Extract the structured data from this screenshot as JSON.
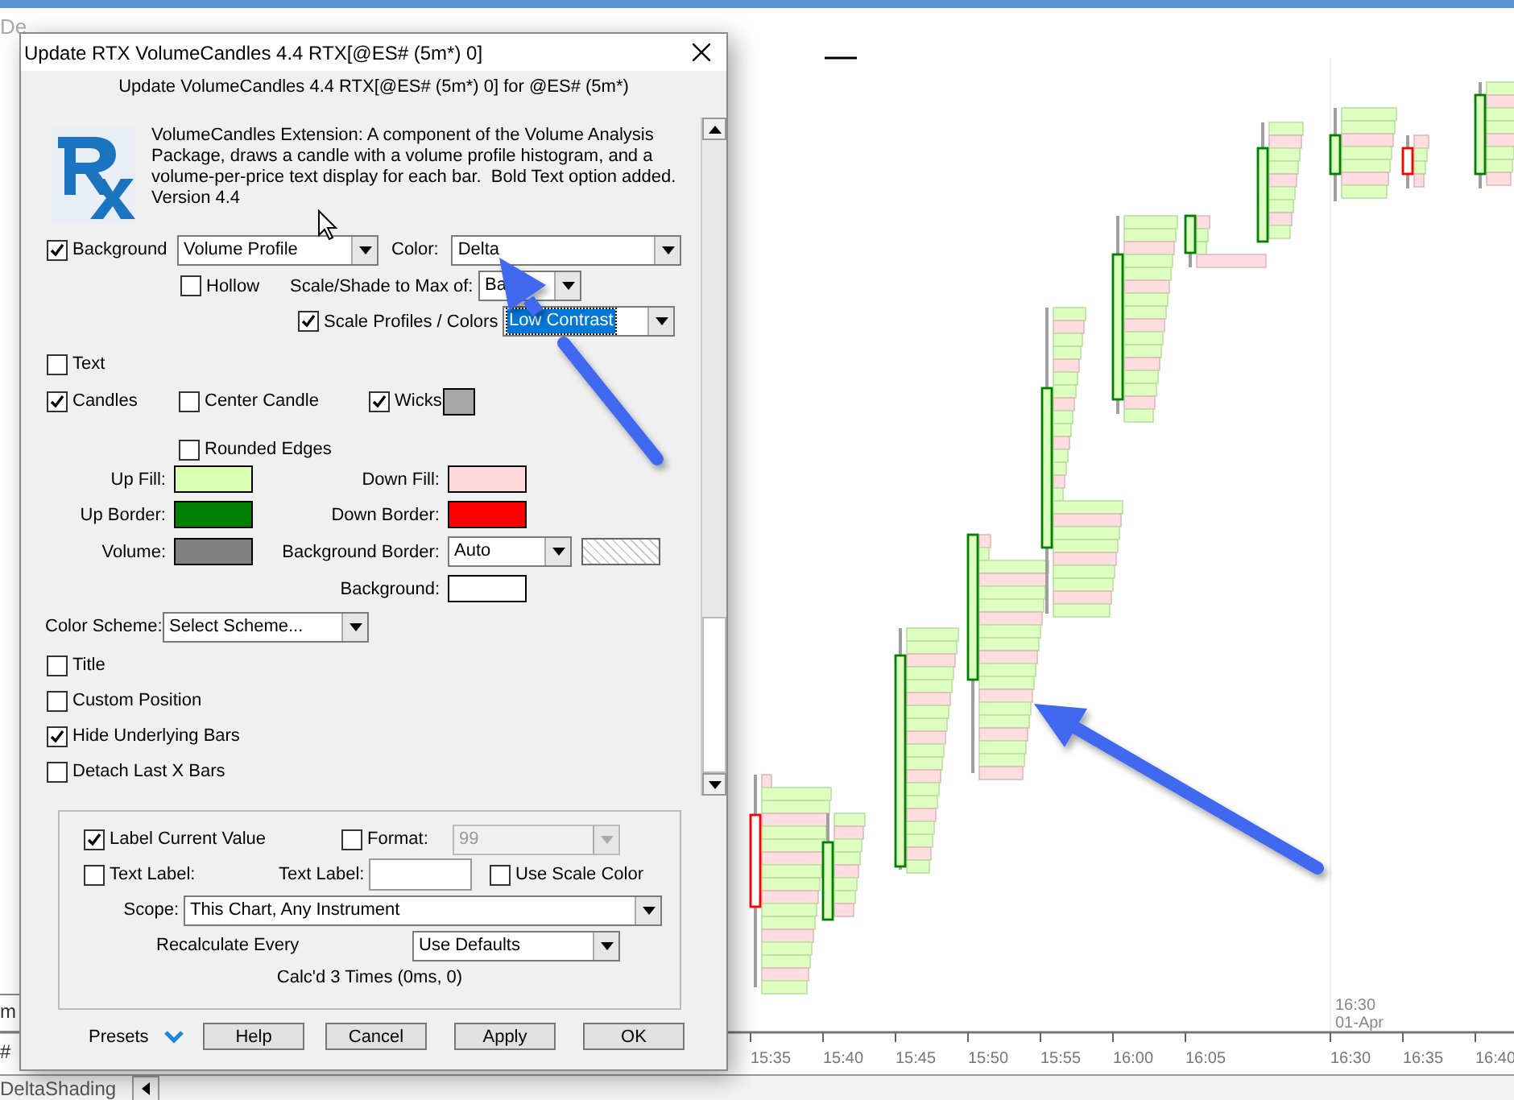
{
  "chart": {
    "title": "De",
    "axis_labels": [
      "15:35",
      "15:40",
      "15:45",
      "15:50",
      "15:55",
      "16:00",
      "16:05",
      "16:30",
      "16:35",
      "16:40"
    ],
    "session_marker": {
      "time": "16:30",
      "date": "01-Apr"
    },
    "side_labels": [
      "m",
      "#"
    ],
    "sheet_tab": "DeltaShading"
  },
  "dialog": {
    "title": "Update RTX VolumeCandles 4.4 RTX[@ES# (5m*) 0]",
    "subtitle": "Update VolumeCandles 4.4 RTX[@ES# (5m*) 0] for @ES# (5m*)",
    "description": "VolumeCandles Extension: A component of the Volume Analysis Package, draws a candle with a volume profile histogram, and a volume-per-price text display for each bar.  Bold Text option added. Version 4.4",
    "background": {
      "label": "Background",
      "checked": true,
      "style": "Volume Profile",
      "color_label": "Color:",
      "color_value": "Delta"
    },
    "hollow": {
      "label": "Hollow",
      "checked": false
    },
    "scale_shade": {
      "label": "Scale/Shade to Max of:",
      "value": "Ba"
    },
    "scale_profiles": {
      "label": "Scale Profiles / Colors",
      "checked": true,
      "value": "Low Contrast",
      "focused": true
    },
    "text_option": {
      "label": "Text",
      "checked": false
    },
    "candle_row": [
      {
        "label": "Candles",
        "checked": true
      },
      {
        "label": "Center Candle",
        "checked": false
      },
      {
        "label": "Wicks",
        "checked": true,
        "color": "#a6a6a6"
      }
    ],
    "rounded_edges": {
      "label": "Rounded Edges",
      "checked": false
    },
    "left_colors": [
      {
        "label": "Up Fill:",
        "color": "#d9ffb3"
      },
      {
        "label": "Up Border:",
        "color": "#008000"
      },
      {
        "label": "Volume:",
        "color": "#808080"
      }
    ],
    "right_colors": [
      {
        "label": "Down Fill:",
        "kind": "swatch",
        "color": "#ffd9d9"
      },
      {
        "label": "Down Border:",
        "kind": "swatch",
        "color": "#ff0000"
      },
      {
        "label": "Background Border:",
        "kind": "dropdown",
        "value": "Auto"
      },
      {
        "label": "Background:",
        "kind": "swatch",
        "color": "#ffffff"
      }
    ],
    "color_scheme": {
      "label": "Color Scheme:",
      "value": "Select Scheme..."
    },
    "options": [
      {
        "label": "Title",
        "checked": false
      },
      {
        "label": "Custom Position",
        "checked": false
      },
      {
        "label": "Hide Underlying Bars",
        "checked": true
      },
      {
        "label": "Detach Last X Bars",
        "checked": false
      }
    ],
    "label_current_value": {
      "label": "Label Current Value",
      "checked": true
    },
    "format": {
      "label": "Format:",
      "checked": false,
      "value": "99",
      "disabled": true
    },
    "text_label_check": {
      "label": "Text Label:",
      "checked": false
    },
    "text_label_field": {
      "label": "Text Label:"
    },
    "use_scale_color": {
      "label": "Use Scale Color",
      "checked": false
    },
    "scope": {
      "label": "Scope:",
      "value": "This Chart, Any Instrument"
    },
    "recalculate": {
      "label": "Recalculate Every",
      "value": "Use Defaults"
    },
    "status": "Calc'd 3 Times (0ms, 0)",
    "presets": "Presets",
    "buttons": [
      "Help",
      "Cancel",
      "Apply",
      "OK"
    ]
  }
}
